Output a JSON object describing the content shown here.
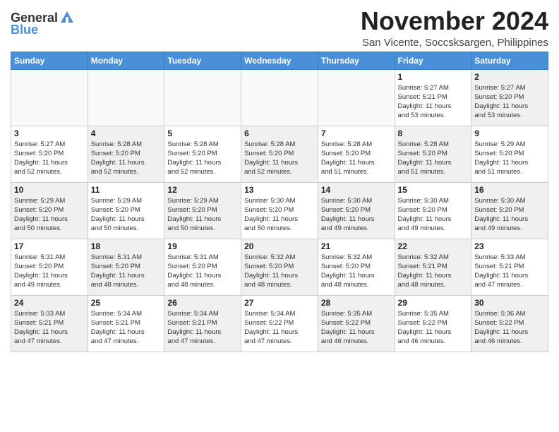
{
  "header": {
    "logo_general": "General",
    "logo_blue": "Blue",
    "month_title": "November 2024",
    "location": "San Vicente, Soccsksargen, Philippines"
  },
  "days_of_week": [
    "Sunday",
    "Monday",
    "Tuesday",
    "Wednesday",
    "Thursday",
    "Friday",
    "Saturday"
  ],
  "weeks": [
    [
      {
        "day": "",
        "info": "",
        "empty": true
      },
      {
        "day": "",
        "info": "",
        "empty": true
      },
      {
        "day": "",
        "info": "",
        "empty": true
      },
      {
        "day": "",
        "info": "",
        "empty": true
      },
      {
        "day": "",
        "info": "",
        "empty": true
      },
      {
        "day": "1",
        "info": "Sunrise: 5:27 AM\nSunset: 5:21 PM\nDaylight: 11 hours\nand 53 minutes."
      },
      {
        "day": "2",
        "info": "Sunrise: 5:27 AM\nSunset: 5:20 PM\nDaylight: 11 hours\nand 53 minutes."
      }
    ],
    [
      {
        "day": "3",
        "info": "Sunrise: 5:27 AM\nSunset: 5:20 PM\nDaylight: 11 hours\nand 52 minutes."
      },
      {
        "day": "4",
        "info": "Sunrise: 5:28 AM\nSunset: 5:20 PM\nDaylight: 11 hours\nand 52 minutes."
      },
      {
        "day": "5",
        "info": "Sunrise: 5:28 AM\nSunset: 5:20 PM\nDaylight: 11 hours\nand 52 minutes."
      },
      {
        "day": "6",
        "info": "Sunrise: 5:28 AM\nSunset: 5:20 PM\nDaylight: 11 hours\nand 52 minutes."
      },
      {
        "day": "7",
        "info": "Sunrise: 5:28 AM\nSunset: 5:20 PM\nDaylight: 11 hours\nand 51 minutes."
      },
      {
        "day": "8",
        "info": "Sunrise: 5:28 AM\nSunset: 5:20 PM\nDaylight: 11 hours\nand 51 minutes."
      },
      {
        "day": "9",
        "info": "Sunrise: 5:29 AM\nSunset: 5:20 PM\nDaylight: 11 hours\nand 51 minutes."
      }
    ],
    [
      {
        "day": "10",
        "info": "Sunrise: 5:29 AM\nSunset: 5:20 PM\nDaylight: 11 hours\nand 50 minutes."
      },
      {
        "day": "11",
        "info": "Sunrise: 5:29 AM\nSunset: 5:20 PM\nDaylight: 11 hours\nand 50 minutes."
      },
      {
        "day": "12",
        "info": "Sunrise: 5:29 AM\nSunset: 5:20 PM\nDaylight: 11 hours\nand 50 minutes."
      },
      {
        "day": "13",
        "info": "Sunrise: 5:30 AM\nSunset: 5:20 PM\nDaylight: 11 hours\nand 50 minutes."
      },
      {
        "day": "14",
        "info": "Sunrise: 5:30 AM\nSunset: 5:20 PM\nDaylight: 11 hours\nand 49 minutes."
      },
      {
        "day": "15",
        "info": "Sunrise: 5:30 AM\nSunset: 5:20 PM\nDaylight: 11 hours\nand 49 minutes."
      },
      {
        "day": "16",
        "info": "Sunrise: 5:30 AM\nSunset: 5:20 PM\nDaylight: 11 hours\nand 49 minutes."
      }
    ],
    [
      {
        "day": "17",
        "info": "Sunrise: 5:31 AM\nSunset: 5:20 PM\nDaylight: 11 hours\nand 49 minutes."
      },
      {
        "day": "18",
        "info": "Sunrise: 5:31 AM\nSunset: 5:20 PM\nDaylight: 11 hours\nand 48 minutes."
      },
      {
        "day": "19",
        "info": "Sunrise: 5:31 AM\nSunset: 5:20 PM\nDaylight: 11 hours\nand 48 minutes."
      },
      {
        "day": "20",
        "info": "Sunrise: 5:32 AM\nSunset: 5:20 PM\nDaylight: 11 hours\nand 48 minutes."
      },
      {
        "day": "21",
        "info": "Sunrise: 5:32 AM\nSunset: 5:20 PM\nDaylight: 11 hours\nand 48 minutes."
      },
      {
        "day": "22",
        "info": "Sunrise: 5:32 AM\nSunset: 5:21 PM\nDaylight: 11 hours\nand 48 minutes."
      },
      {
        "day": "23",
        "info": "Sunrise: 5:33 AM\nSunset: 5:21 PM\nDaylight: 11 hours\nand 47 minutes."
      }
    ],
    [
      {
        "day": "24",
        "info": "Sunrise: 5:33 AM\nSunset: 5:21 PM\nDaylight: 11 hours\nand 47 minutes."
      },
      {
        "day": "25",
        "info": "Sunrise: 5:34 AM\nSunset: 5:21 PM\nDaylight: 11 hours\nand 47 minutes."
      },
      {
        "day": "26",
        "info": "Sunrise: 5:34 AM\nSunset: 5:21 PM\nDaylight: 11 hours\nand 47 minutes."
      },
      {
        "day": "27",
        "info": "Sunrise: 5:34 AM\nSunset: 5:22 PM\nDaylight: 11 hours\nand 47 minutes."
      },
      {
        "day": "28",
        "info": "Sunrise: 5:35 AM\nSunset: 5:22 PM\nDaylight: 11 hours\nand 46 minutes."
      },
      {
        "day": "29",
        "info": "Sunrise: 5:35 AM\nSunset: 5:22 PM\nDaylight: 11 hours\nand 46 minutes."
      },
      {
        "day": "30",
        "info": "Sunrise: 5:36 AM\nSunset: 5:22 PM\nDaylight: 11 hours\nand 46 minutes."
      }
    ]
  ]
}
